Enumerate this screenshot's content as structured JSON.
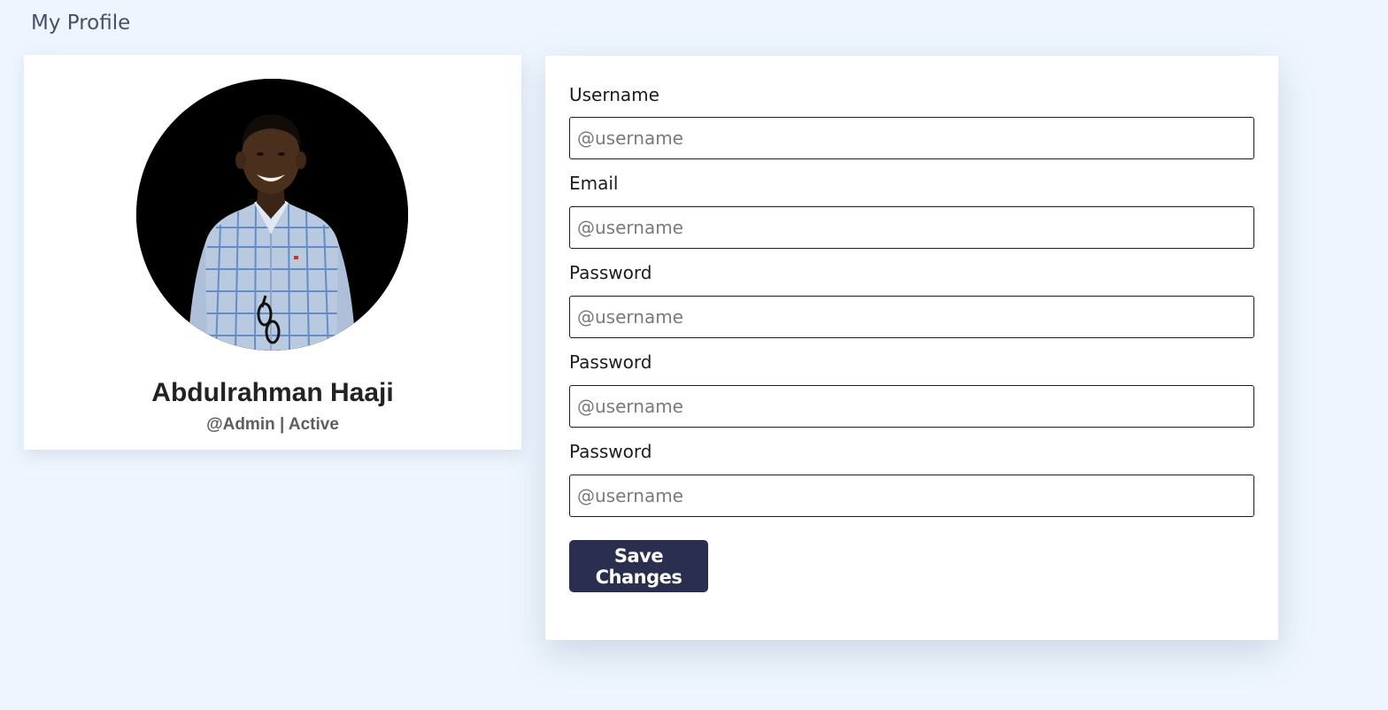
{
  "page": {
    "title": "My Profile"
  },
  "profile": {
    "name": "Abdulrahman Haaji",
    "meta": "@Admin | Active",
    "avatar_icon": "user-photo"
  },
  "form": {
    "fields": [
      {
        "label": "Username",
        "placeholder": "@username",
        "value": ""
      },
      {
        "label": "Email",
        "placeholder": "@username",
        "value": ""
      },
      {
        "label": "Password",
        "placeholder": "@username",
        "value": ""
      },
      {
        "label": "Password",
        "placeholder": "@username",
        "value": ""
      },
      {
        "label": "Password",
        "placeholder": "@username",
        "value": ""
      }
    ],
    "save_label": "Save Changes"
  },
  "colors": {
    "background": "#eef5fe",
    "card": "#ffffff",
    "button": "#2a2e4f",
    "title": "#4a4f66"
  }
}
